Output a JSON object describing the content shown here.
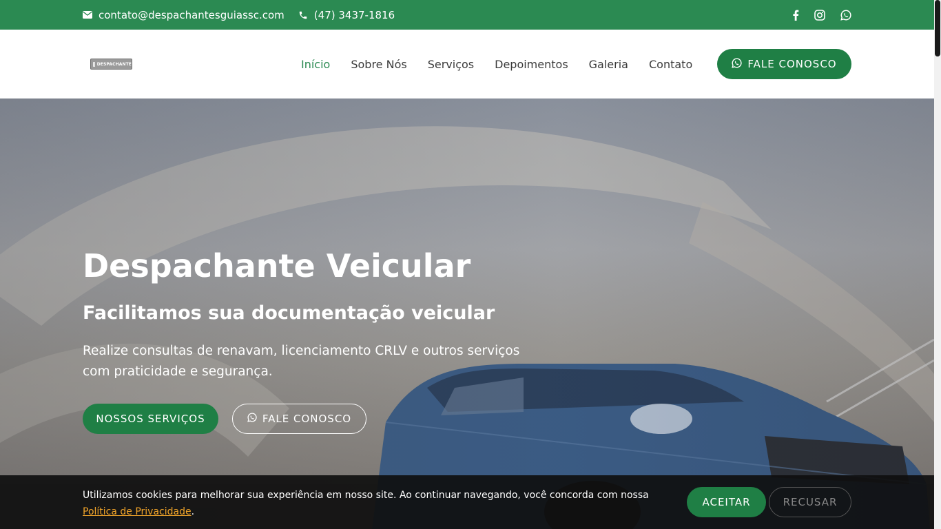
{
  "topbar": {
    "email": "contato@despachantesguiassc.com",
    "phone": "(47) 3437-1816",
    "icons": {
      "email": "envelope-icon",
      "phone": "phone-icon",
      "social": [
        "facebook-icon",
        "instagram-icon",
        "whatsapp-icon"
      ]
    }
  },
  "header": {
    "logo_text": "DESPACHANTE",
    "nav": [
      {
        "label": "Início",
        "active": true
      },
      {
        "label": "Sobre Nós"
      },
      {
        "label": "Serviços"
      },
      {
        "label": "Depoimentos"
      },
      {
        "label": "Galeria"
      },
      {
        "label": "Contato"
      }
    ],
    "cta_label": "FALE CONOSCO"
  },
  "hero": {
    "title": "Despachante Veicular",
    "subtitle": "Facilitamos sua documentação veicular",
    "text": "Realize consultas de renavam, licenciamento CRLV e outros serviços com praticidade e segurança.",
    "primary_button": "NOSSOS SERVIÇOS",
    "secondary_button": "FALE CONOSCO"
  },
  "cookie": {
    "text": "Utilizamos cookies para melhorar sua experiência em nosso site. Ao continuar navegando, você concorda com nossa",
    "link": "Política de Privacidade",
    "suffix": ".",
    "accept": "ACEITAR",
    "refuse": "RECUSAR"
  },
  "colors": {
    "brand": "#2b8a52",
    "button": "#1f7f45",
    "link": "#f2a52a"
  }
}
